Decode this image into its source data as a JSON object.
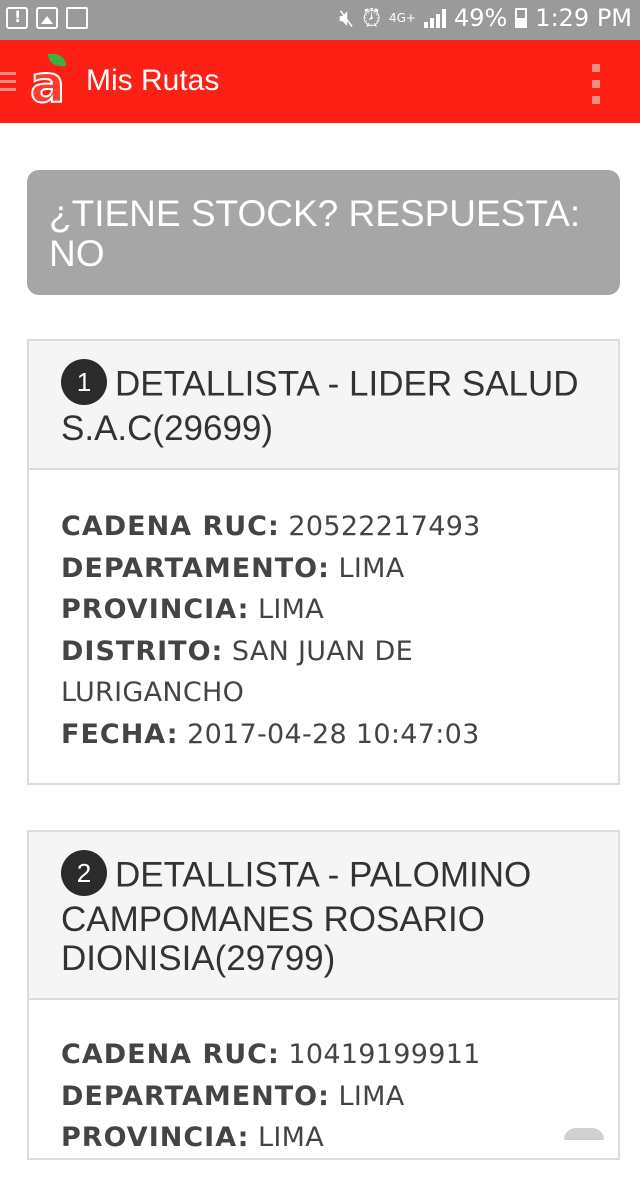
{
  "status_bar": {
    "network": "4G+",
    "battery": "49%",
    "time": "1:29 PM",
    "icons": [
      "alert-icon",
      "image-icon",
      "recycle-icon",
      "mute-icon",
      "alarm-icon",
      "signal-icon",
      "battery-icon"
    ]
  },
  "app_bar": {
    "title": "Mis Rutas",
    "logo_letter": "a",
    "color": "#ff2015"
  },
  "answer": {
    "text": "¿TIENE STOCK? RESPUESTA: NO"
  },
  "cards": [
    {
      "number": "1",
      "title": "DETALLISTA - LIDER SALUD S.A.C(29699)",
      "fields": [
        {
          "label": "CADENA RUC:",
          "value": "20522217493"
        },
        {
          "label": "DEPARTAMENTO:",
          "value": "LIMA"
        },
        {
          "label": "PROVINCIA:",
          "value": "LIMA"
        },
        {
          "label": "DISTRITO:",
          "value": "SAN JUAN DE LURIGANCHO"
        },
        {
          "label": "FECHA:",
          "value": "2017-04-28 10:47:03"
        }
      ]
    },
    {
      "number": "2",
      "title": "DETALLISTA - PALOMINO CAMPOMANES ROSARIO DIONISIA(29799)",
      "fields": [
        {
          "label": "CADENA RUC:",
          "value": "10419199911"
        },
        {
          "label": "DEPARTAMENTO:",
          "value": "LIMA"
        },
        {
          "label": "PROVINCIA:",
          "value": "LIMA"
        }
      ]
    }
  ]
}
